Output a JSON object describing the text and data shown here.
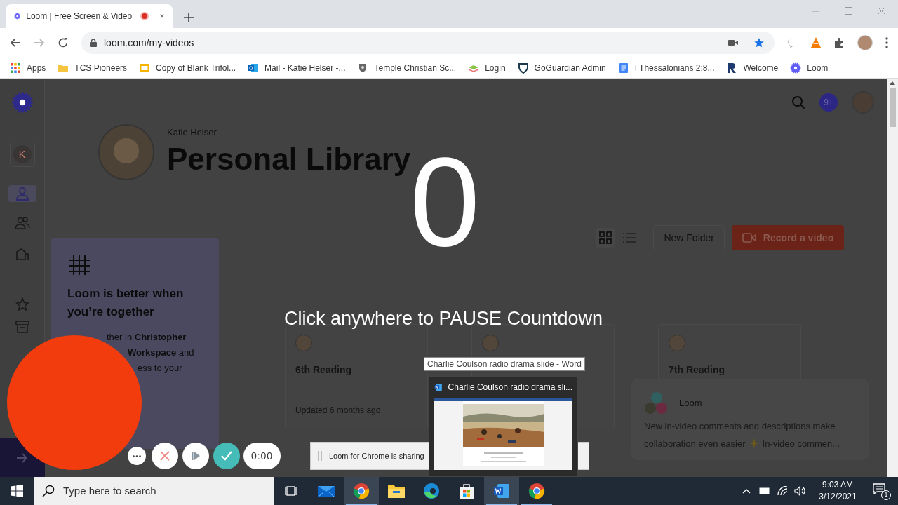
{
  "browser": {
    "tab": {
      "title": "Loom | Free Screen & Video",
      "recording": true
    },
    "address": "loom.com/my-videos",
    "bookmarks": [
      {
        "label": "Apps",
        "kind": "apps"
      },
      {
        "label": "TCS Pioneers",
        "kind": "folder"
      },
      {
        "label": "Copy of Blank Trifol...",
        "kind": "slides"
      },
      {
        "label": "Mail - Katie Helser -...",
        "kind": "mail"
      },
      {
        "label": "Temple Christian Sc...",
        "kind": "crest"
      },
      {
        "label": "Login",
        "kind": "book"
      },
      {
        "label": "GoGuardian Admin",
        "kind": "shield"
      },
      {
        "label": "I Thessalonians 2:8...",
        "kind": "doc"
      },
      {
        "label": "Welcome",
        "kind": "r"
      },
      {
        "label": "Loom",
        "kind": "loom"
      }
    ]
  },
  "sidebar": {
    "avatar_letter": "K",
    "items": [
      {
        "kind": "person",
        "selected": true
      },
      {
        "kind": "team",
        "selected": false
      },
      {
        "kind": "building",
        "selected": false
      },
      {
        "kind": "star",
        "selected": false
      },
      {
        "kind": "archive",
        "selected": false
      }
    ]
  },
  "header": {
    "user_name": "Katie Helser",
    "title": "Personal Library",
    "notifications": "9+"
  },
  "toolbar": {
    "new_folder": "New Folder",
    "record": "Record a video"
  },
  "countdown": {
    "value": "0",
    "hint": "Click anywhere to PAUSE Countdown"
  },
  "promo": {
    "title": "Loom is better when you’re together",
    "lines": [
      "ther in **Christopher**",
      "**Workspace** and",
      "ess to your"
    ]
  },
  "videos": [
    {
      "avatar": true,
      "title": "6th Reading",
      "updated": "Updated 6 months ago"
    },
    {
      "avatar": true
    },
    {
      "avatar": true,
      "title": "7th Reading"
    }
  ],
  "recorder": {
    "timer": "0:00"
  },
  "sharing_bar": "Loom for Chrome is sharing",
  "tooltip": "Charlie Coulson radio drama slide - Word",
  "preview": {
    "title": "Charlie Coulson radio drama sli..."
  },
  "toast": {
    "sender": "Loom",
    "body": "New in-video comments and descriptions make",
    "body2": "collaboration even easier",
    "more": "In-video commen..."
  },
  "taskbar": {
    "search_placeholder": "Type here to search",
    "apps": [
      {
        "kind": "taskview",
        "active": false
      },
      {
        "kind": "mail",
        "active": false
      },
      {
        "kind": "chrome",
        "active": true,
        "highlighted": true
      },
      {
        "kind": "explorer",
        "active": false
      },
      {
        "kind": "edge",
        "active": false
      },
      {
        "kind": "store",
        "active": false
      },
      {
        "kind": "word",
        "active": true,
        "highlighted": true
      },
      {
        "kind": "chrome",
        "active": true
      }
    ],
    "time": "9:03 AM",
    "date": "3/12/2021",
    "notification_count": "1"
  }
}
